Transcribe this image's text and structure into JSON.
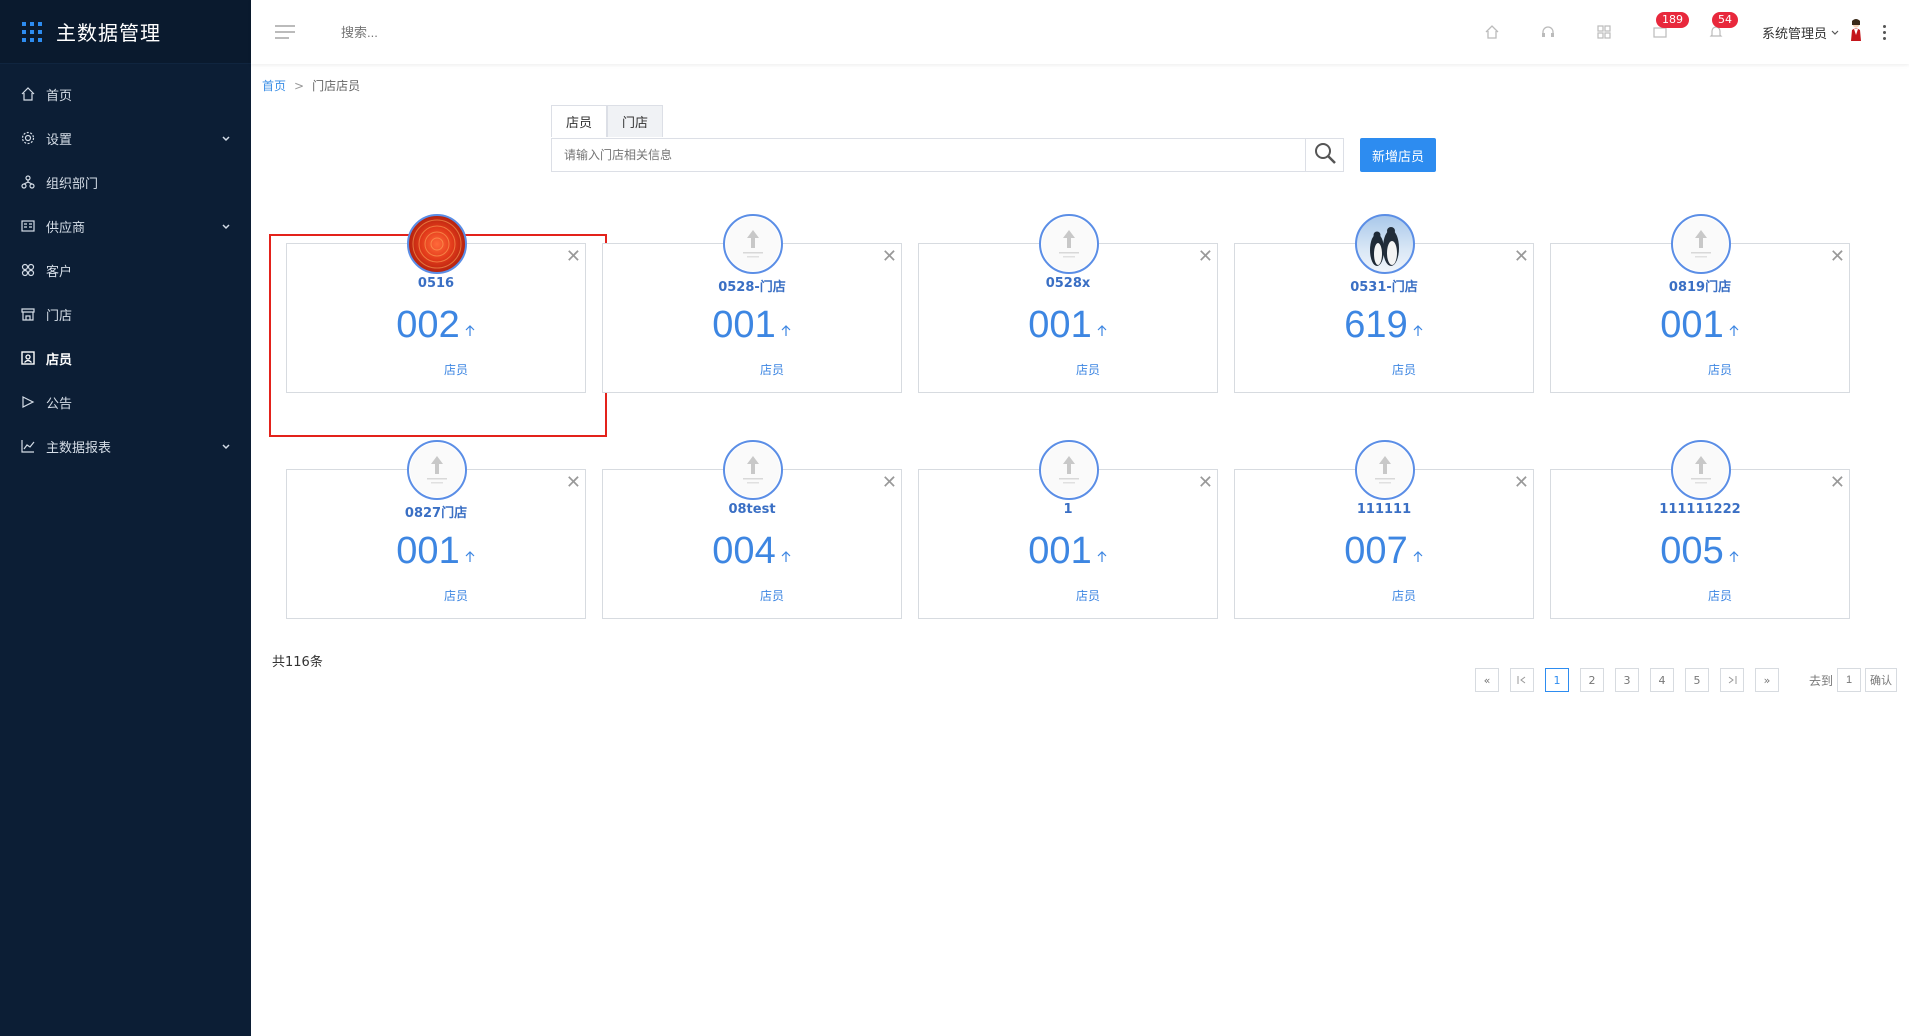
{
  "app": {
    "title": "主数据管理"
  },
  "sidebar": {
    "items": [
      {
        "label": "首页",
        "icon": "home-icon",
        "has_children": false,
        "active": false
      },
      {
        "label": "设置",
        "icon": "gear-icon",
        "has_children": true,
        "active": false
      },
      {
        "label": "组织部门",
        "icon": "org-chart-icon",
        "has_children": false,
        "active": false
      },
      {
        "label": "供应商",
        "icon": "id-card-icon",
        "has_children": true,
        "active": false
      },
      {
        "label": "客户",
        "icon": "customer-icon",
        "has_children": false,
        "active": false
      },
      {
        "label": "门店",
        "icon": "store-icon",
        "has_children": false,
        "active": false
      },
      {
        "label": "店员",
        "icon": "staff-icon",
        "has_children": false,
        "active": true
      },
      {
        "label": "公告",
        "icon": "announcement-icon",
        "has_children": false,
        "active": false
      },
      {
        "label": "主数据报表",
        "icon": "line-chart-icon",
        "has_children": true,
        "active": false
      }
    ]
  },
  "topbar": {
    "search_placeholder": "搜索...",
    "mail_badge": "189",
    "bell_badge": "54",
    "user_name": "系统管理员"
  },
  "breadcrumb": {
    "home": "首页",
    "separator": ">",
    "current": "门店店员"
  },
  "search": {
    "tabs": [
      "店员",
      "门店"
    ],
    "placeholder": "请输入门店相关信息",
    "add_button": "新增店员"
  },
  "cards": [
    {
      "name": "0516",
      "count": "002",
      "label": "店员",
      "avatar": "red",
      "selected": true
    },
    {
      "name": "0528-门店",
      "count": "001",
      "label": "店员",
      "avatar": "default",
      "selected": false
    },
    {
      "name": "0528x",
      "count": "001",
      "label": "店员",
      "avatar": "default",
      "selected": false
    },
    {
      "name": "0531-门店",
      "count": "619",
      "label": "店员",
      "avatar": "penguin",
      "selected": false
    },
    {
      "name": "0819门店",
      "count": "001",
      "label": "店员",
      "avatar": "default",
      "selected": false
    },
    {
      "name": "0827门店",
      "count": "001",
      "label": "店员",
      "avatar": "default",
      "selected": false
    },
    {
      "name": "08test",
      "count": "004",
      "label": "店员",
      "avatar": "default",
      "selected": false
    },
    {
      "name": "1",
      "count": "001",
      "label": "店员",
      "avatar": "default",
      "selected": false
    },
    {
      "name": "111111",
      "count": "007",
      "label": "店员",
      "avatar": "default",
      "selected": false
    },
    {
      "name": "111111222",
      "count": "005",
      "label": "店员",
      "avatar": "default",
      "selected": false
    }
  ],
  "total_text": "共116条",
  "pagination": {
    "first": "«",
    "prev": "«",
    "pages": [
      "1",
      "2",
      "3",
      "4",
      "5"
    ],
    "current": "1",
    "next": "»",
    "last": "»",
    "goto_label": "去到",
    "goto_value": "1",
    "confirm": "确认"
  },
  "colors": {
    "sidebar_bg": "#0c1e35",
    "accent": "#2d8cf0",
    "highlight": "#e3221b",
    "badge": "#e8283c"
  }
}
